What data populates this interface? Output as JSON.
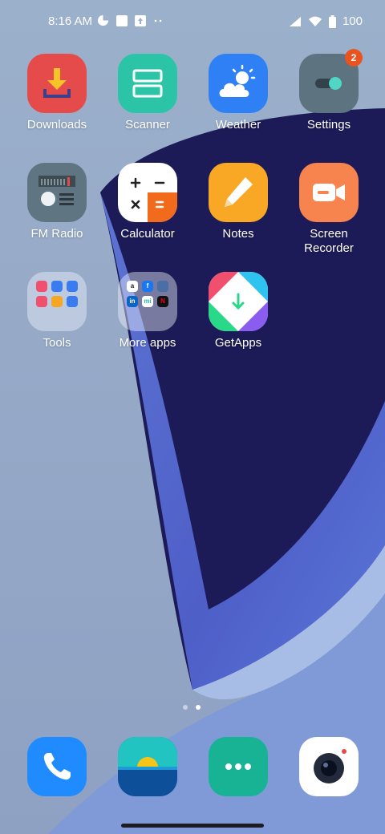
{
  "status": {
    "time": "8:16 AM",
    "battery": "100"
  },
  "apps": {
    "row1": [
      {
        "label": "Downloads"
      },
      {
        "label": "Scanner"
      },
      {
        "label": "Weather"
      },
      {
        "label": "Settings",
        "badge": "2"
      }
    ],
    "row2": [
      {
        "label": "FM Radio"
      },
      {
        "label": "Calculator"
      },
      {
        "label": "Notes"
      },
      {
        "label": "Screen\nRecorder"
      }
    ],
    "row3": [
      {
        "label": "Tools"
      },
      {
        "label": "More apps"
      },
      {
        "label": "GetApps"
      }
    ]
  },
  "pages": {
    "count": 2,
    "active": 2
  },
  "dock": [
    "phone-icon",
    "gallery-icon",
    "messaging-icon",
    "camera-icon"
  ],
  "colors": {
    "downloads": "#e64b4b",
    "scanner": "#2bc4a7",
    "weather": "#2f80f5",
    "settings": "#5d7480",
    "radio": "#5f7581",
    "notes": "#f9a826",
    "recorder": "#f7834f",
    "phone": "#1f8bff",
    "messaging": "#18b394"
  }
}
